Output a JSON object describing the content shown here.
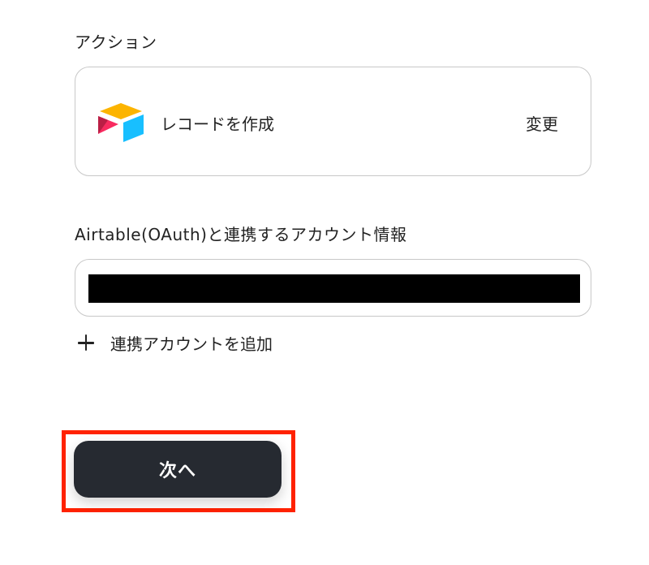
{
  "action_section": {
    "label": "アクション",
    "app_icon": "airtable-logo",
    "action_name": "レコードを作成",
    "change_label": "変更"
  },
  "account_section": {
    "label": "Airtable(OAuth)と連携するアカウント情報",
    "selected_value": "",
    "add_account_label": "連携アカウントを追加",
    "add_icon": "plus-icon"
  },
  "footer": {
    "next_label": "次へ",
    "highlight_color": "#ff2200"
  },
  "colors": {
    "button_bg": "#262a31",
    "border": "#c8c8c8",
    "airtable_yellow": "#fcb400",
    "airtable_red": "#f82b60",
    "airtable_blue": "#18bfff"
  }
}
